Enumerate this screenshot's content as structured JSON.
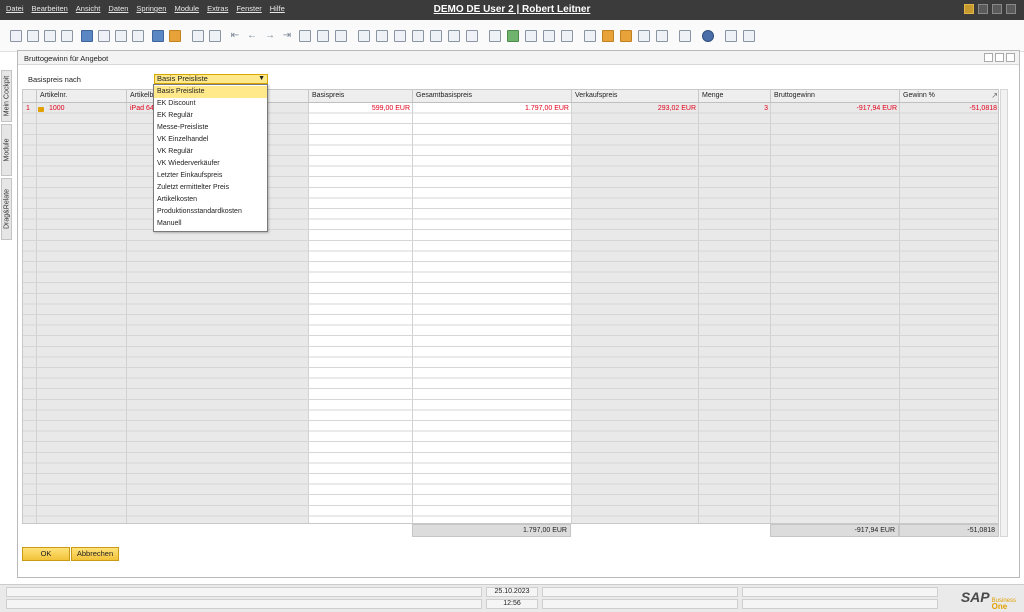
{
  "app": {
    "title": "DEMO DE User 2 | Robert Leitner",
    "menu": [
      "Datei",
      "Bearbeiten",
      "Ansicht",
      "Daten",
      "Springen",
      "Module",
      "Extras",
      "Fenster",
      "Hilfe"
    ]
  },
  "sidetabs": [
    "Mein Cockpit",
    "Module",
    "Drag&Relate"
  ],
  "form": {
    "title": "Bruttogewinn für Angebot",
    "basis_label": "Basispreis nach",
    "basis_value": "Basis Preisliste",
    "dropdown_options": [
      "Basis Preisliste",
      "EK Discount",
      "EK Regulär",
      "Messe-Preisliste",
      "VK Einzelhandel",
      "VK Regulär",
      "VK Wiederverkäufer",
      "Letzter Einkaufspreis",
      "Zuletzt ermittelter Preis",
      "Artikelkosten",
      "Produktionsstandardkosten",
      "Manuell"
    ],
    "columns": [
      "Artikelnr.",
      "Artikelb",
      "Basispreis",
      "Gesamtbasispreis",
      "Verkaufspreis",
      "Menge",
      "Bruttogewinn",
      "Gewinn %"
    ],
    "rows": [
      {
        "num": "1",
        "artikelnr": "1000",
        "artikelbez": "iPad 64G",
        "basispreis": "599,00 EUR",
        "gesamtbasispreis": "1.797,00 EUR",
        "verkaufspreis": "293,02 EUR",
        "menge": "3",
        "bruttogewinn": "-917,94 EUR",
        "gewinn": "-51,0818"
      }
    ],
    "totals": {
      "gesamtbasispreis": "1.797,00 EUR",
      "bruttogewinn": "-917,94 EUR",
      "gewinn": "-51,0818"
    },
    "ok_label": "OK",
    "cancel_label": "Abbrechen"
  },
  "status": {
    "date": "25.10.2023",
    "time": "12:56",
    "logo_main": "SAP",
    "logo_sub1": "Business",
    "logo_sub2": "One"
  },
  "colors": {
    "highlight": "#ffe98a",
    "red_text": "#e0001a",
    "titlebar": "#3b3b3b"
  }
}
